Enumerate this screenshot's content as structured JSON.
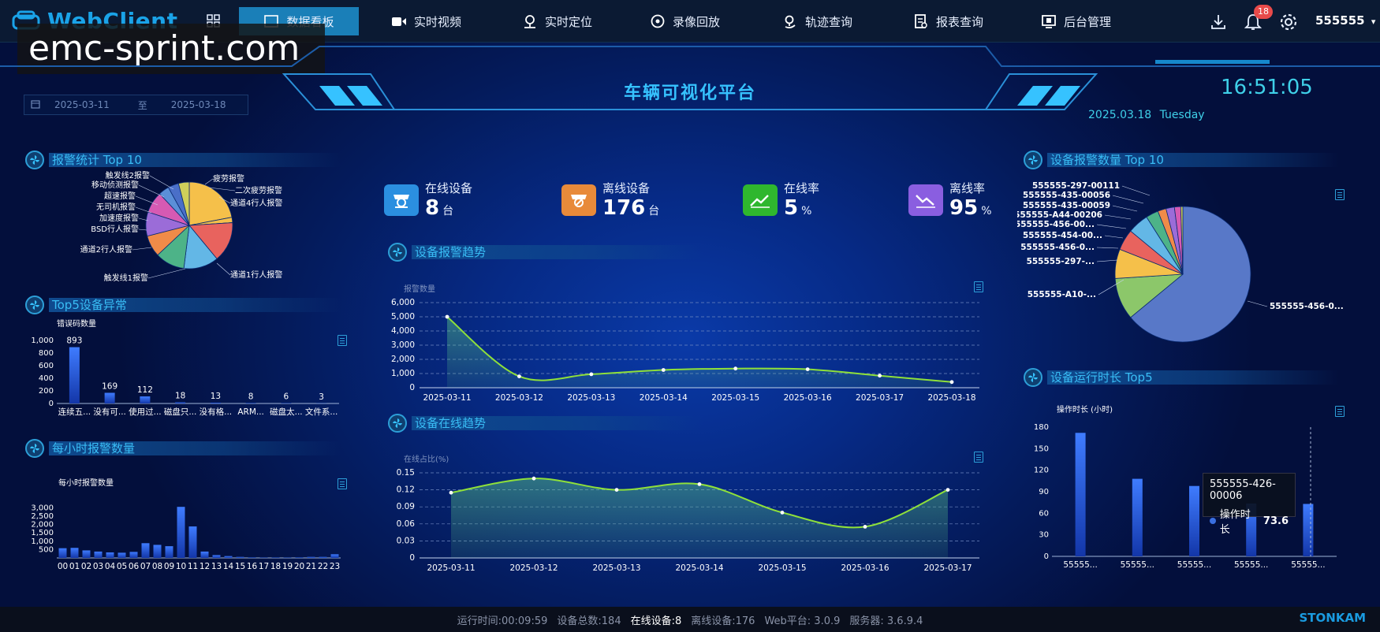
{
  "app": {
    "logo_text": "WebClient",
    "watermark": "emc-sprint.com"
  },
  "nav": {
    "items": [
      {
        "label": "数据看板",
        "icon": "dashboard-icon",
        "active": true
      },
      {
        "label": "实时视频",
        "icon": "video-icon"
      },
      {
        "label": "实时定位",
        "icon": "location-icon"
      },
      {
        "label": "录像回放",
        "icon": "playback-icon"
      },
      {
        "label": "轨迹查询",
        "icon": "track-icon"
      },
      {
        "label": "报表查询",
        "icon": "report-icon"
      },
      {
        "label": "后台管理",
        "icon": "admin-icon"
      }
    ],
    "notification_count": "18",
    "username": "555555"
  },
  "header": {
    "title": "车辆可视化平台",
    "time": "16:51:05",
    "date": "2025.03.18",
    "weekday": "Tuesday",
    "range_start": "2025-03-11",
    "range_sep": "至",
    "range_end": "2025-03-18"
  },
  "kpis": [
    {
      "label": "在线设备",
      "value": "8",
      "unit": "台",
      "color": "#2b8fe0",
      "icon": "camera-icon"
    },
    {
      "label": "离线设备",
      "value": "176",
      "unit": "台",
      "color": "#e88a3a",
      "icon": "camera-offline-icon"
    },
    {
      "label": "在线率",
      "value": "5",
      "unit": "%",
      "color": "#2fb72e",
      "icon": "trend-up-icon"
    },
    {
      "label": "离线率",
      "value": "95",
      "unit": "%",
      "color": "#8a5ee0",
      "icon": "trend-down-icon"
    }
  ],
  "sections": {
    "alarm_top10": "报警统计 Top 10",
    "top5_abnormal": "Top5设备异常",
    "hourly_alarm": "每小时报警数量",
    "alarm_trend": "设备报警趋势",
    "online_trend": "设备在线趋势",
    "device_alarm_top10": "设备报警数量 Top 10",
    "runtime_top5": "设备运行时长 Top5"
  },
  "chart_data": [
    {
      "id": "alarm-top10-pie",
      "type": "pie",
      "labels": [
        "疲劳报警",
        "二次疲劳报警",
        "通道4行人报警",
        "通道1行人报警",
        "触发线1报警",
        "通道2行人报警",
        "BSD行人报警",
        "加速度报警",
        "无司机报警",
        "超速报警",
        "移动侦测报警",
        "触发线2报警"
      ],
      "values": [
        22,
        2,
        0.01,
        15,
        13,
        11,
        8,
        9,
        8,
        4,
        4,
        4
      ],
      "colors": [
        "#f5c04a",
        "#f5c04a",
        "#f5c04a",
        "#e8635e",
        "#63b7e6",
        "#4db388",
        "#f08b48",
        "#9b6cd8",
        "#d65ab3",
        "#5b8fd8",
        "#4a6fc8",
        "#cfcf5a"
      ]
    },
    {
      "id": "top5-abnormal-bar",
      "type": "bar",
      "ylabel": "错误码数量",
      "categories": [
        "连续五...",
        "没有可...",
        "使用过...",
        "磁盘只...",
        "没有格...",
        "ARM...",
        "磁盘太...",
        "文件系..."
      ],
      "values": [
        893,
        169,
        112,
        18,
        13,
        8,
        6,
        3
      ],
      "ylim": [
        0,
        1000
      ],
      "yticks": [
        "0",
        "200",
        "400",
        "600",
        "800",
        "1,000"
      ]
    },
    {
      "id": "hourly-alarm-bar",
      "type": "bar",
      "ylabel": "每小时报警数量",
      "categories": [
        "00",
        "01",
        "02",
        "03",
        "04",
        "05",
        "06",
        "07",
        "08",
        "09",
        "10",
        "11",
        "12",
        "13",
        "14",
        "15",
        "16",
        "17",
        "18",
        "19",
        "20",
        "21",
        "22",
        "23"
      ],
      "values": [
        580,
        600,
        450,
        380,
        330,
        310,
        360,
        880,
        780,
        700,
        3050,
        1880,
        380,
        170,
        110,
        60,
        30,
        20,
        25,
        20,
        30,
        60,
        60,
        220
      ],
      "ylim": [
        0,
        3200
      ],
      "yticks": [
        "500",
        "1,000",
        "1,500",
        "2,000",
        "2,500",
        "3,000"
      ]
    },
    {
      "id": "alarm-trend-area",
      "type": "area",
      "ylabel": "报警数量",
      "x": [
        "2025-03-11",
        "2025-03-12",
        "2025-03-13",
        "2025-03-14",
        "2025-03-15",
        "2025-03-16",
        "2025-03-17",
        "2025-03-18"
      ],
      "values": [
        5000,
        800,
        950,
        1250,
        1350,
        1300,
        850,
        400
      ],
      "ylim": [
        0,
        6000
      ],
      "yticks": [
        "0",
        "1,000",
        "2,000",
        "3,000",
        "4,000",
        "5,000",
        "6,000"
      ]
    },
    {
      "id": "online-trend-area",
      "type": "area",
      "ylabel": "在线占比(%)",
      "x": [
        "2025-03-11",
        "2025-03-12",
        "2025-03-13",
        "2025-03-14",
        "2025-03-15",
        "2025-03-16",
        "2025-03-17"
      ],
      "values": [
        0.115,
        0.14,
        0.12,
        0.13,
        0.08,
        0.055,
        0.12
      ],
      "ylim": [
        0,
        0.15
      ],
      "yticks": [
        "0",
        "0.03",
        "0.06",
        "0.09",
        "0.12",
        "0.15"
      ]
    },
    {
      "id": "device-alarm-top10-pie",
      "type": "pie",
      "labels": [
        "555555-456-0...",
        "555555-A10-...",
        "555555-297-...",
        "555555-456-0...",
        "555555-454-00...",
        "555555-456-00...",
        "555555-A44-00206",
        "555555-435-00059",
        "555555-435-00056",
        "555555-297-00111"
      ],
      "values": [
        64,
        10,
        7,
        5,
        5,
        3,
        2,
        2,
        1.5,
        0.5
      ],
      "colors": [
        "#5878c8",
        "#8cc76a",
        "#f5c04a",
        "#e8635e",
        "#63b7e6",
        "#4db388",
        "#f08b48",
        "#9b6cd8",
        "#d65ab3",
        "#cfcf5a"
      ]
    },
    {
      "id": "runtime-top5-bar",
      "type": "bar",
      "ylabel": "操作时长 (小时)",
      "categories": [
        "55555...",
        "55555...",
        "55555...",
        "55555...",
        "55555..."
      ],
      "values": [
        172,
        108,
        98,
        73.6,
        73
      ],
      "ylim": [
        0,
        180
      ],
      "yticks": [
        "0",
        "30",
        "60",
        "90",
        "120",
        "150",
        "180"
      ],
      "tooltip": {
        "name": "555555-426-00006",
        "series": "操作时长",
        "value": "73.6"
      }
    }
  ],
  "footer": {
    "runtime": "运行时间:00:09:59",
    "total": "设备总数:184",
    "online": "在线设备:8",
    "offline": "离线设备:176",
    "web": "Web平台: 3.0.9",
    "server": "服务器: 3.6.9.4",
    "brand": "STONKAM"
  }
}
